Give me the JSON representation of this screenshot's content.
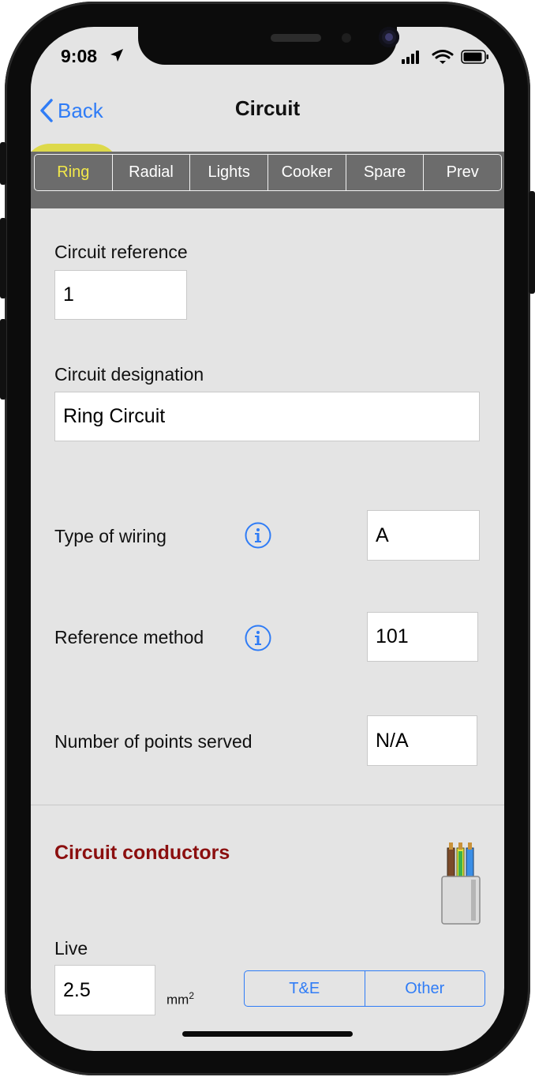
{
  "status_bar": {
    "time": "9:08"
  },
  "nav": {
    "back_label": "Back",
    "title": "Circuit"
  },
  "segments": [
    "Ring",
    "Radial",
    "Lights",
    "Cooker",
    "Spare",
    "Prev"
  ],
  "selected_segment": "Ring",
  "form": {
    "circuit_reference": {
      "label": "Circuit reference",
      "value": "1"
    },
    "circuit_designation": {
      "label": "Circuit designation",
      "value": "Ring Circuit"
    },
    "type_of_wiring": {
      "label": "Type of wiring",
      "value": "A"
    },
    "reference_method": {
      "label": "Reference method",
      "value": "101"
    },
    "number_of_points": {
      "label": "Number of points served",
      "value": "N/A"
    }
  },
  "conductors": {
    "title": "Circuit conductors",
    "live_label": "Live",
    "live_value": "2.5",
    "unit": "mm",
    "unit_exp": "2",
    "cable_types": [
      "T&E",
      "Other"
    ]
  },
  "colors": {
    "accent": "#2f7cf6",
    "section_title": "#8b0f0f",
    "highlight": "#dcd728",
    "segbar_bg": "#6c6c6c"
  }
}
